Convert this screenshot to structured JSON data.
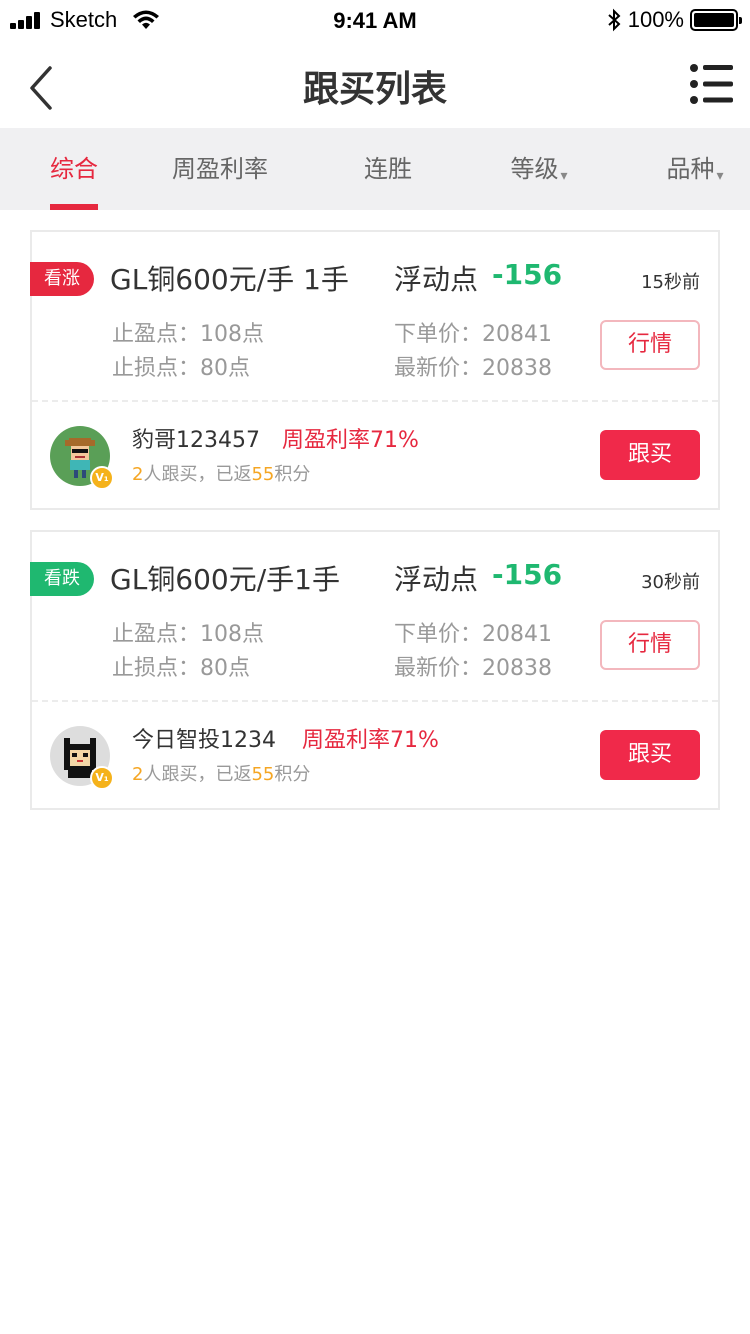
{
  "status_bar": {
    "carrier": "Sketch",
    "time": "9:41 AM",
    "battery": "100%"
  },
  "nav": {
    "title": "跟买列表"
  },
  "tabs": [
    {
      "label": "综合",
      "active": true
    },
    {
      "label": "周盈利率",
      "active": false
    },
    {
      "label": "连胜",
      "active": false
    },
    {
      "label": "等级",
      "active": false,
      "dropdown": true
    },
    {
      "label": "品种",
      "active": false,
      "dropdown": true
    }
  ],
  "dropdown_arrow": "▾",
  "cards": [
    {
      "badge": "看涨",
      "direction": "up",
      "product": "GL铜600元/手 1手",
      "float_label": "浮动点",
      "float_value": "-156",
      "time_ago": "15秒前",
      "take_profit": "止盈点：108点",
      "stop_loss": "止损点：80点",
      "order_price": "下单价：20841",
      "latest_price": "最新价：20838",
      "market_button": "行情",
      "username": "豹哥123457",
      "weekly_rate": "周盈利率71%",
      "followers_count": "2",
      "followers_text": "人跟买，已返",
      "points": "55",
      "points_unit": "积分",
      "follow_button": "跟买",
      "avatar_icon": "pixel-boy-avatar"
    },
    {
      "badge": "看跌",
      "direction": "down",
      "product": "GL铜600元/手1手",
      "float_label": "浮动点",
      "float_value": "-156",
      "time_ago": "30秒前",
      "take_profit": "止盈点：108点",
      "stop_loss": "止损点：80点",
      "order_price": "下单价：20841",
      "latest_price": "最新价：20838",
      "market_button": "行情",
      "username": "今日智投1234",
      "weekly_rate": "周盈利率71%",
      "followers_count": "2",
      "followers_text": "人跟买，已返",
      "points": "55",
      "points_unit": "积分",
      "follow_button": "跟买",
      "avatar_icon": "pixel-cat-avatar"
    }
  ],
  "vip_badge": "V₁",
  "colors": {
    "accent_red": "#e6283f",
    "green": "#1fb870",
    "orange": "#f5a623",
    "tab_bg": "#f0f0f2"
  }
}
